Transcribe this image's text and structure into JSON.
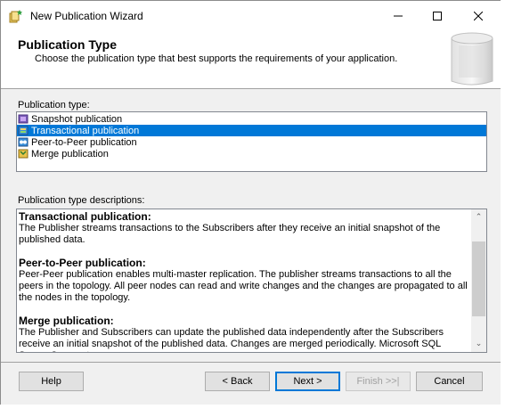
{
  "window": {
    "title": "New Publication Wizard",
    "minimize_label": "—",
    "maximize_label": "☐",
    "close_label": "✕"
  },
  "header": {
    "title": "Publication Type",
    "subtitle": "Choose the publication type that best supports the requirements of your application."
  },
  "publication_list": {
    "label": "Publication type:",
    "items": [
      {
        "label": "Snapshot publication",
        "icon": "snapshot-publication-icon",
        "selected": false
      },
      {
        "label": "Transactional publication",
        "icon": "transactional-publication-icon",
        "selected": true
      },
      {
        "label": "Peer-to-Peer publication",
        "icon": "peer-to-peer-publication-icon",
        "selected": false
      },
      {
        "label": "Merge publication",
        "icon": "merge-publication-icon",
        "selected": false
      }
    ]
  },
  "descriptions": {
    "label": "Publication type descriptions:",
    "sections": [
      {
        "heading": "Transactional publication:",
        "text": "The Publisher streams transactions to the Subscribers after they receive an initial snapshot of the published data."
      },
      {
        "heading": "Peer-to-Peer publication:",
        "text": "Peer-Peer publication enables multi-master replication. The publisher streams transactions to all the peers in the topology. All peer nodes can read and write changes and the changes are propagated to all the nodes in the topology."
      },
      {
        "heading": "Merge publication:",
        "text": "The Publisher and Subscribers can update the published data independently after the Subscribers receive an initial snapshot of the published data. Changes are merged periodically. Microsoft SQL Server Compact"
      }
    ],
    "scroll_up": "⌃",
    "scroll_down": "⌄"
  },
  "buttons": {
    "help": "Help",
    "back": "< Back",
    "next": "Next >",
    "finish": "Finish >>|",
    "cancel": "Cancel"
  },
  "colors": {
    "selection": "#0078d7",
    "window_bg": "#f0f0f0"
  }
}
